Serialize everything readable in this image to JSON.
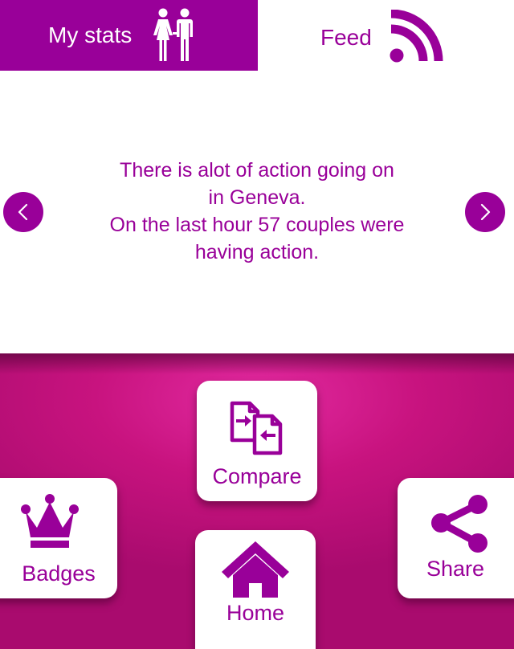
{
  "tabs": {
    "my_stats": {
      "label": "My stats",
      "icon": "couple-icon",
      "active": true
    },
    "feed": {
      "label": "Feed",
      "icon": "rss-feed-icon",
      "active": false
    }
  },
  "feed": {
    "lines": [
      "There is alot of action going on",
      "in Geneva.",
      "On the last hour 57 couples were",
      "having action."
    ],
    "prev_icon": "chevron-left-icon",
    "next_icon": "chevron-right-icon"
  },
  "actions": {
    "compare": {
      "label": "Compare",
      "icon": "compare-icon"
    },
    "badges": {
      "label": "Badges",
      "icon": "crown-icon"
    },
    "share": {
      "label": "Share",
      "icon": "share-icon"
    },
    "home": {
      "label": "Home",
      "icon": "home-icon"
    }
  },
  "colors": {
    "brand": "#990099",
    "panel_gradient": [
      "#e22aa0",
      "#c8137f",
      "#a90b6e"
    ],
    "card": "#ffffff"
  }
}
